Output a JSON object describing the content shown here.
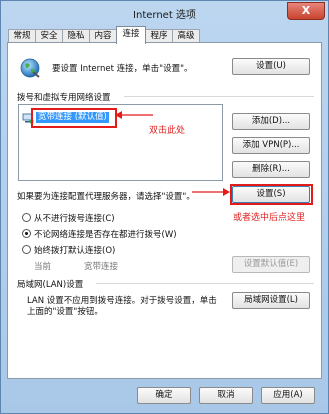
{
  "window": {
    "title": "Internet 选项",
    "close_glyph": "X"
  },
  "tabs": [
    {
      "label": "常规"
    },
    {
      "label": "安全"
    },
    {
      "label": "隐私"
    },
    {
      "label": "内容"
    },
    {
      "label": "连接"
    },
    {
      "label": "程序"
    },
    {
      "label": "高级"
    }
  ],
  "active_tab": "连接",
  "setup": {
    "text": "要设置 Internet 连接，单击\"设置\"。",
    "button": "设置(U)"
  },
  "dialup": {
    "section_label": "拨号和虚拟专用网络设置",
    "connections": [
      {
        "label": "宽带连接 (默认值)",
        "selected": true
      }
    ],
    "buttons": {
      "add": "添加(D)...",
      "add_vpn": "添加 VPN(P)...",
      "remove": "删除(R)...",
      "settings": "设置(S)"
    },
    "proxy_hint": "如果要为连接配置代理服务器，请选择\"设置\"。",
    "radio_options": [
      {
        "label": "从不进行拨号连接(C)",
        "checked": false
      },
      {
        "label": "不论网络连接是否存在都进行拨号(W)",
        "checked": true
      },
      {
        "label": "始终拨打默认连接(O)",
        "checked": false
      }
    ],
    "current_label": "当前",
    "current_value": "宽带连接",
    "set_default_button": "设置默认值(E)"
  },
  "lan": {
    "section_label": "局域网(LAN)设置",
    "description_line1": "LAN 设置不应用到拨号连接。对于拨号设置，单击",
    "description_line2": "上面的\"设置\"按钮。",
    "button": "局域网设置(L)"
  },
  "footer": {
    "ok": "确定",
    "cancel": "取消",
    "apply": "应用(A)"
  },
  "annotations": {
    "double_click": "双击此处",
    "or_select": "或者选中后点这里",
    "color": "#e41b1b"
  }
}
